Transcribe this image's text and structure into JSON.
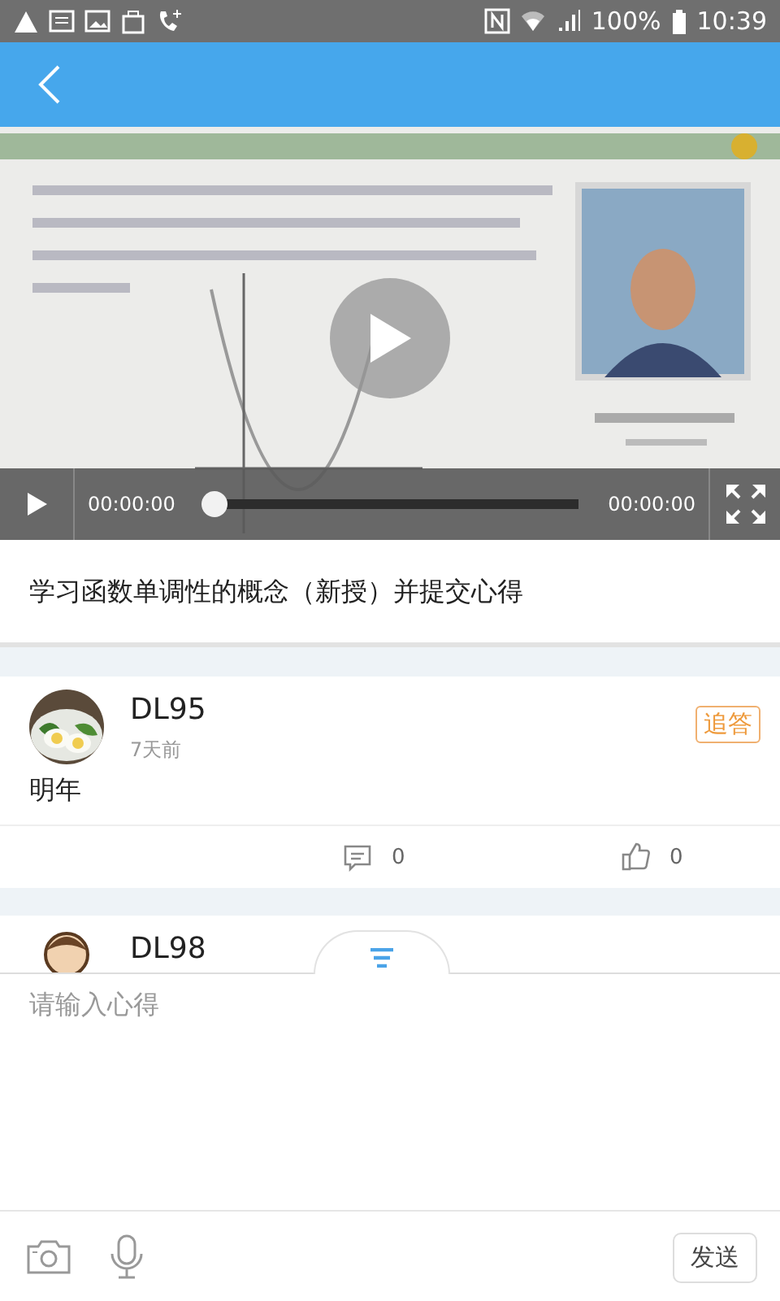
{
  "status_bar": {
    "battery": "100%",
    "time": "10:39"
  },
  "video": {
    "kind": "picture",
    "current_time": "00:00:00",
    "duration": "00:00:00",
    "level": 0
  },
  "lesson_title": "学习函数单调性的概念（新授）并提交心得",
  "comments": [
    {
      "user": "DL95",
      "time": "7天前",
      "text": "明年",
      "action": "追答",
      "replies": "0",
      "likes": "0"
    },
    {
      "user": "DL98"
    }
  ],
  "composer": {
    "placeholder": "请输入心得",
    "send": "发送"
  }
}
